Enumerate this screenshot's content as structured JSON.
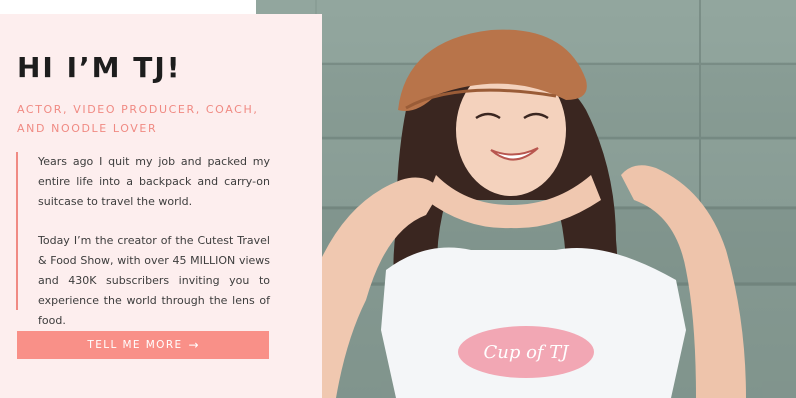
{
  "hero": {
    "title": "HI I’M TJ!",
    "subtitle": "ACTOR, VIDEO PRODUCER, COACH, AND NOODLE LOVER",
    "bio_paragraphs": [
      "Years ago I quit my job and packed my entire life into a backpack and carry-on suitcase to travel the world.",
      "Today I’m the creator of the Cutest Travel & Food Show, with over 45 MILLION views and 430K subscribers inviting you to experience the world through the lens of food."
    ],
    "cta_label": "TELL ME MORE",
    "cta_icon": "arrow-right-icon",
    "shirt_text": "Cup of TJ"
  },
  "colors": {
    "panel_bg": "#fdeeee",
    "accent": "#f08a83",
    "button_bg": "#f99088",
    "title_text": "#1d1d1d",
    "body_text": "#3d3d3d"
  }
}
